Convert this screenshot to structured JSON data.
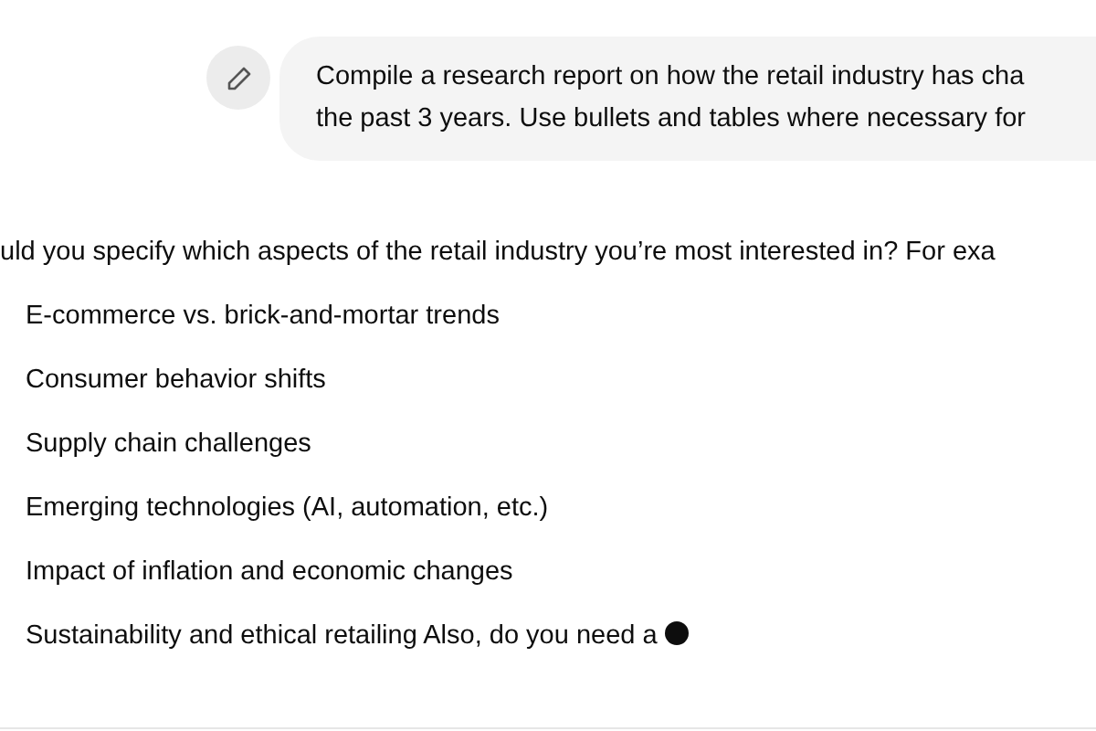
{
  "user_message": {
    "lines": [
      "Compile a research report on how the retail industry has cha",
      "the past 3 years. Use bullets and tables where necessary for"
    ]
  },
  "assistant_message": {
    "intro": "uld you specify which aspects of the retail industry you’re most interested in? For exa",
    "items": [
      "E-commerce vs. brick-and-mortar trends",
      "Consumer behavior shifts",
      "Supply chain challenges",
      "Emerging technologies (AI, automation, etc.)",
      "Impact of inflation and economic changes",
      "Sustainability and ethical retailing Also, do you need a"
    ],
    "streaming": true
  }
}
